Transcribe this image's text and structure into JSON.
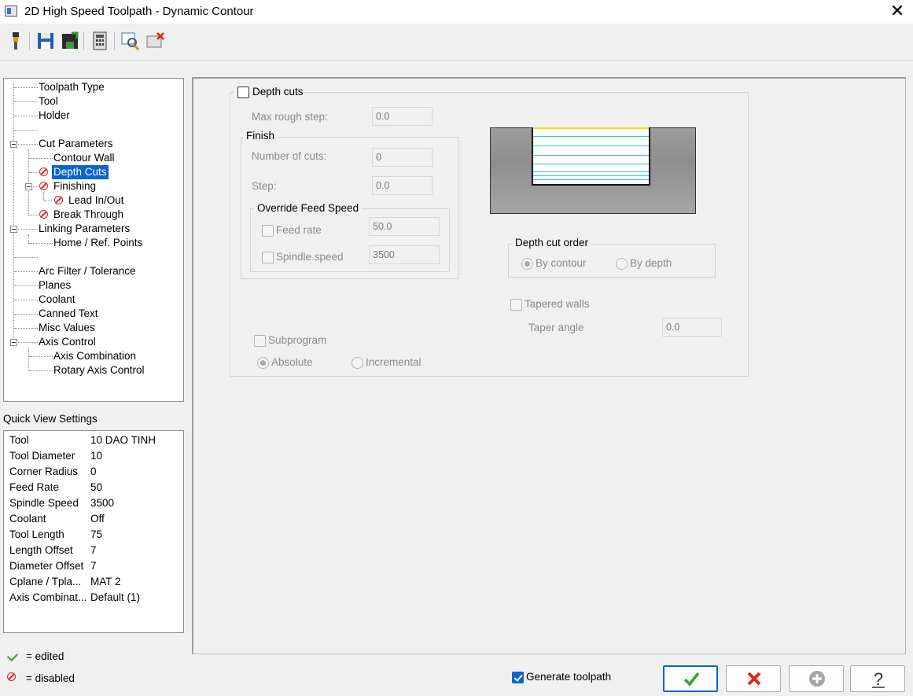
{
  "window": {
    "title": "2D High Speed Toolpath - Dynamic Contour",
    "close_label": "✕"
  },
  "toolbar": {
    "buttons": [
      "tool-icon",
      "save-icon",
      "save-as-icon",
      "calculator-icon",
      "zoom-icon",
      "delete-icon"
    ]
  },
  "tree": {
    "items": [
      {
        "label": "Toolpath Type"
      },
      {
        "label": "Tool"
      },
      {
        "label": "Holder"
      },
      {
        "label": ""
      },
      {
        "label": "Cut Parameters"
      },
      {
        "label": "Contour Wall"
      },
      {
        "label": "Depth Cuts",
        "selected": true,
        "disabled_icon": true
      },
      {
        "label": "Finishing",
        "disabled_icon": true
      },
      {
        "label": "Lead In/Out",
        "disabled_icon": true
      },
      {
        "label": "Break Through",
        "disabled_icon": true
      },
      {
        "label": "Linking Parameters"
      },
      {
        "label": "Home / Ref. Points"
      },
      {
        "label": ""
      },
      {
        "label": "Arc Filter / Tolerance"
      },
      {
        "label": "Planes"
      },
      {
        "label": "Coolant"
      },
      {
        "label": "Canned Text"
      },
      {
        "label": "Misc Values"
      },
      {
        "label": "Axis Control"
      },
      {
        "label": "Axis Combination"
      },
      {
        "label": "Rotary Axis Control"
      }
    ]
  },
  "quick_view": {
    "label": "Quick View Settings",
    "rows": [
      {
        "key": "Tool",
        "value": "10 DAO TINH"
      },
      {
        "key": "Tool Diameter",
        "value": "10"
      },
      {
        "key": "Corner Radius",
        "value": "0"
      },
      {
        "key": "Feed Rate",
        "value": "50"
      },
      {
        "key": "Spindle Speed",
        "value": "3500"
      },
      {
        "key": "Coolant",
        "value": "Off"
      },
      {
        "key": "Tool Length",
        "value": "75"
      },
      {
        "key": "Length Offset",
        "value": "7"
      },
      {
        "key": "Diameter Offset",
        "value": "7"
      },
      {
        "key": "Cplane / Tpla...",
        "value": "MAT 2"
      },
      {
        "key": "Axis Combinat...",
        "value": "Default (1)"
      }
    ]
  },
  "legend": {
    "edited": "= edited",
    "disabled": "= disabled"
  },
  "depth_cuts": {
    "label": "Depth cuts",
    "checked": false,
    "max_rough_step": {
      "label": "Max rough step:",
      "value": "0.0"
    },
    "finish": {
      "label": "Finish",
      "number_of_cuts": {
        "label": "Number of cuts:",
        "value": "0"
      },
      "step": {
        "label": "Step:",
        "value": "0.0"
      },
      "override": {
        "label": "Override Feed Speed",
        "feed_rate": {
          "label": "Feed rate",
          "value": "50.0"
        },
        "spindle_speed": {
          "label": "Spindle speed",
          "value": "3500"
        }
      }
    },
    "depth_cut_order": {
      "label": "Depth cut order",
      "options": [
        "By contour",
        "By depth"
      ],
      "selected": "By contour"
    },
    "tapered_walls": {
      "label": "Tapered walls",
      "taper_angle_label": "Taper angle",
      "taper_angle_value": "0.0"
    },
    "subprogram": {
      "label": "Subprogram",
      "options": [
        "Absolute",
        "Incremental"
      ],
      "selected": "Absolute"
    }
  },
  "footer": {
    "generate_toolpath": {
      "label": "Generate toolpath",
      "checked": true
    },
    "buttons": [
      "ok-icon",
      "cancel-icon",
      "add-icon",
      "help-icon"
    ]
  },
  "colors": {
    "accent": "#0a64d2",
    "ok_green": "#2fa52f",
    "cancel_red": "#e0261b",
    "preview_line": "#2bc6d8",
    "preview_top": "#f0e400"
  }
}
